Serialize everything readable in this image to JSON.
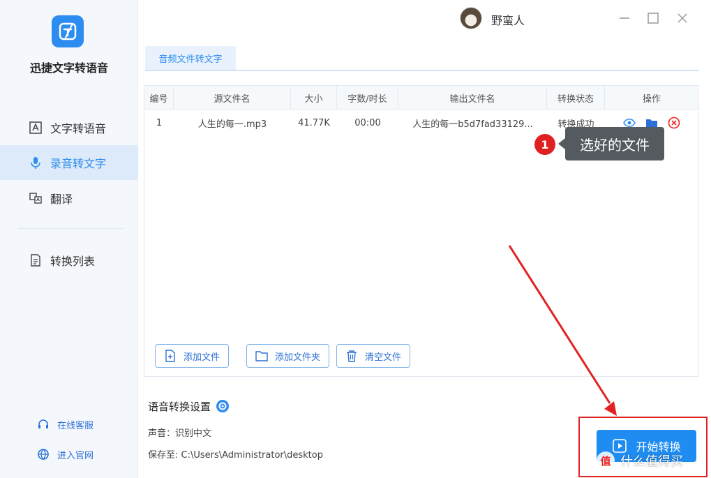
{
  "app": {
    "name": "迅捷文字转语音"
  },
  "sidebar": {
    "items": [
      {
        "label": "文字转语音",
        "icon": "text-to-speech-icon"
      },
      {
        "label": "录音转文字",
        "icon": "microphone-icon"
      },
      {
        "label": "翻译",
        "icon": "translate-icon"
      },
      {
        "label": "转换列表",
        "icon": "list-icon"
      }
    ],
    "footer": [
      {
        "label": "在线客服",
        "icon": "headset-icon"
      },
      {
        "label": "进入官网",
        "icon": "globe-icon"
      }
    ]
  },
  "user": {
    "name": "野蛮人"
  },
  "tab": {
    "label": "音频文件转文字"
  },
  "table": {
    "columns": [
      "编号",
      "源文件名",
      "大小",
      "字数/时长",
      "输出文件名",
      "转换状态",
      "操作"
    ],
    "rows": [
      {
        "no": "1",
        "source": "人生的每一.mp3",
        "size": "41.77K",
        "duration": "00:00",
        "output": "人生的每一b5d7fad33129...",
        "status": "转换成功"
      }
    ]
  },
  "toolbar": {
    "add_file": "添加文件",
    "add_folder": "添加文件夹",
    "clear_files": "清空文件"
  },
  "annotation": {
    "step": "1",
    "text": "选好的文件"
  },
  "settings": {
    "title": "语音转换设置",
    "voice": "声音：识别中文",
    "save_path": "保存至: C:\\Users\\Administrator\\desktop"
  },
  "start_button": {
    "label": "开始转换"
  },
  "watermark": {
    "text": "什么值得买",
    "logo": "值"
  },
  "colors": {
    "accent": "#2d8cf0",
    "annotation_red": "#e22222",
    "tooltip_bg": "#555a60"
  }
}
